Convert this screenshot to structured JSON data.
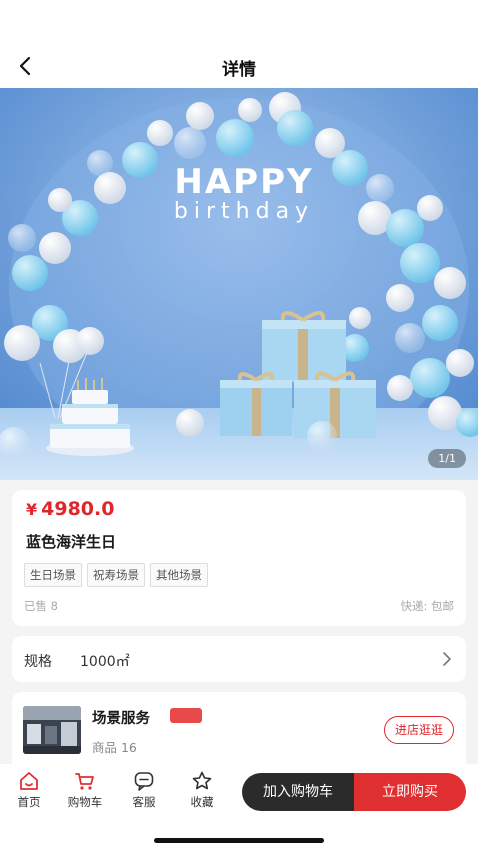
{
  "header": {
    "title": "详情",
    "back_icon": "chevron-left-icon"
  },
  "banner": {
    "headline": "HAPPY",
    "subline": "birthday",
    "pager": "1/1",
    "colors": {
      "background": "#6f9fd9",
      "balloon_blue": "#8fd2ee",
      "balloon_white": "#f4f6fa"
    }
  },
  "product": {
    "currency": "¥",
    "price": "4980.0",
    "name": "蓝色海洋生日",
    "tags": [
      "生日场景",
      "祝寿场景",
      "其他场景"
    ],
    "sold": "已售 8",
    "shipping": "快递: 包邮",
    "price_color": "#e0262a"
  },
  "spec": {
    "label": "规格",
    "value": "1000㎡",
    "arrow_icon": "chevron-right-icon"
  },
  "shop": {
    "name": "场景服务",
    "count": "商品 16",
    "visit_label": "进店逛逛"
  },
  "bottom_nav": {
    "items": [
      {
        "label": "首页",
        "icon": "home-icon"
      },
      {
        "label": "购物车",
        "icon": "cart-icon"
      },
      {
        "label": "客服",
        "icon": "chat-icon"
      },
      {
        "label": "收藏",
        "icon": "star-icon"
      }
    ],
    "add_to_cart": "加入购物车",
    "buy_now": "立即购买",
    "accent": "#e02f31"
  }
}
